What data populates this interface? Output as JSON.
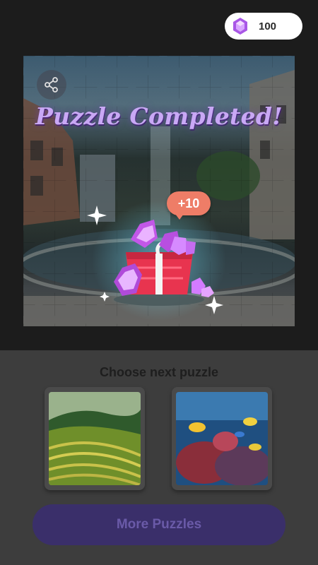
{
  "header": {
    "gem_count": "100",
    "gem_icon": "purple-gem-icon"
  },
  "completion": {
    "title": "Puzzle Completed!",
    "reward": "+10",
    "share_icon": "share-icon"
  },
  "next": {
    "title": "Choose next puzzle",
    "puzzles": [
      {
        "subject": "rice terraces"
      },
      {
        "subject": "coral reef fish"
      }
    ]
  },
  "actions": {
    "more_label": "More Puzzles"
  },
  "colors": {
    "accent_purple": "#c9a8f5",
    "reward_bubble": "#ee7d67",
    "gift_box": "#e8344f",
    "button_bg": "#3a2f6a"
  }
}
